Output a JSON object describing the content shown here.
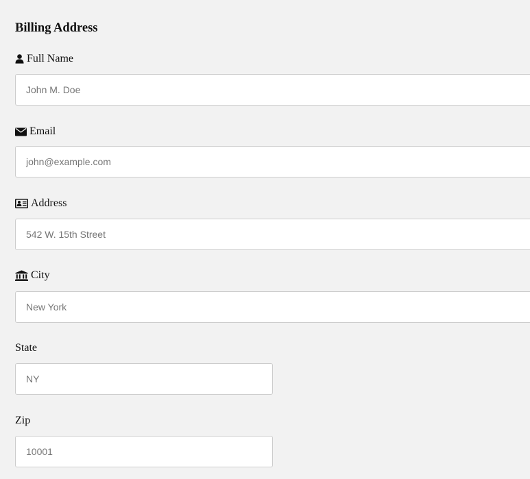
{
  "form": {
    "heading": "Billing Address",
    "fields": {
      "full_name": {
        "label": "Full Name",
        "icon": "user-icon",
        "placeholder": "John M. Doe"
      },
      "email": {
        "label": "Email",
        "icon": "envelope-icon",
        "placeholder": "john@example.com"
      },
      "address": {
        "label": "Address",
        "icon": "address-card-icon",
        "placeholder": "542 W. 15th Street"
      },
      "city": {
        "label": "City",
        "icon": "institution-icon",
        "placeholder": "New York"
      },
      "state": {
        "label": "State",
        "placeholder": "NY"
      },
      "zip": {
        "label": "Zip",
        "placeholder": "10001"
      }
    }
  }
}
